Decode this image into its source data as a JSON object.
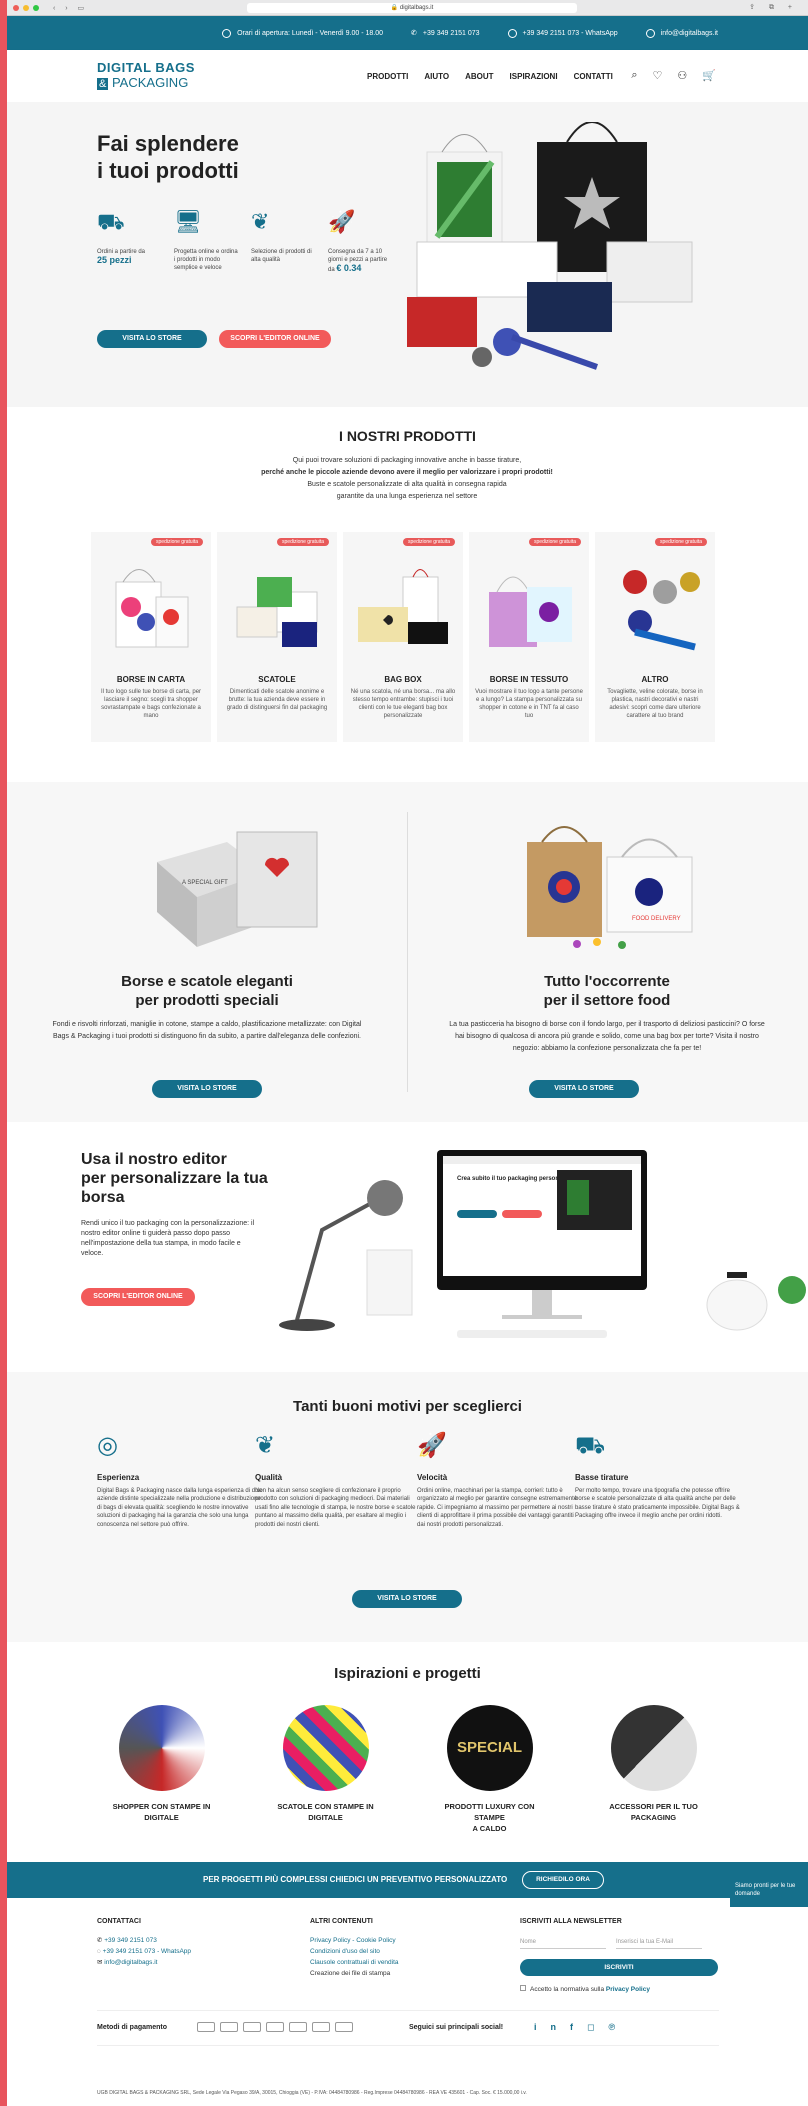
{
  "browser": {
    "url": "digitalbags.it"
  },
  "topbar": {
    "hours": "Orari di apertura: Lunedì - Venerdì 9.00 - 18.00",
    "phone": "+39 349 2151 073",
    "whatsapp": "+39 349 2151 073 - WhatsApp",
    "email": "info@digitalbags.it"
  },
  "header": {
    "logo_line1": "DIGITAL BAGS",
    "logo_amp": "&",
    "logo_line2": "PACKAGING",
    "menu": [
      "PRODOTTI",
      "AIUTO",
      "ABOUT",
      "ISPIRAZIONI",
      "CONTATTI"
    ]
  },
  "hero": {
    "title_line1": "Fai splendere",
    "title_line2": "i tuoi prodotti",
    "features": [
      {
        "text": "Ordini a partire da",
        "highlight": "25 pezzi"
      },
      {
        "text": "Progetta online e ordina i prodotti in modo semplice e veloce",
        "highlight": ""
      },
      {
        "text": "Selezione di prodotti di alta qualità",
        "highlight": ""
      },
      {
        "text": "Consegna da 7 a 10 giorni e pezzi a partire da",
        "highlight": "€ 0.34"
      }
    ],
    "btn_store": "VISITA LO STORE",
    "btn_editor": "SCOPRI L'EDITOR ONLINE"
  },
  "products": {
    "title": "I NOSTRI PRODOTTI",
    "intro": [
      "Qui puoi trovare soluzioni di packaging innovative anche in basse tirature,",
      "perché anche le piccole aziende devono avere il meglio per valorizzare i propri prodotti!",
      "Buste e scatole personalizzate di alta qualità in consegna rapida",
      "garantite da una lunga esperienza nel settore"
    ],
    "badge": "spedizione gratuita",
    "items": [
      {
        "name": "BORSE IN CARTA",
        "desc": "Il tuo logo sulle tue borse di carta, per lasciare il segno: scegli tra shopper sovrastampate e bags confezionate a mano"
      },
      {
        "name": "SCATOLE",
        "desc": "Dimenticati delle scatole anonime e brutte: la tua azienda deve essere in grado di distinguersi fin dal packaging"
      },
      {
        "name": "BAG BOX",
        "desc": "Né una scatola, né una borsa... ma allo stesso tempo entrambe: stupisci i tuoi clienti con le tue eleganti bag box personalizzate"
      },
      {
        "name": "BORSE IN TESSUTO",
        "desc": "Vuoi mostrare il tuo logo a tante persone e a lungo? La stampa personalizzata su shopper in cotone e in TNT fa al caso tuo"
      },
      {
        "name": "ALTRO",
        "desc": "Tovagliette, veline colorate, borse in plastica, nastri decorativi e nastri adesivi: scopri come dare ulteriore carattere al tuo brand"
      }
    ]
  },
  "split": {
    "left": {
      "title_line1": "Borse e scatole eleganti",
      "title_line2": "per prodotti speciali",
      "desc": "Fondi e risvolti rinforzati, maniglie in cotone, stampe a caldo, plastificazione metallizzate: con Digital Bags & Packaging i tuoi prodotti si distinguono fin da subito, a partire dall'eleganza delle confezioni.",
      "btn": "VISITA LO STORE",
      "box_label": "A SPECIAL GIFT"
    },
    "right": {
      "title_line1": "Tutto l'occorrente",
      "title_line2": "per il settore food",
      "desc": "La tua pasticceria ha bisogno di borse con il fondo largo, per il trasporto di deliziosi pasticcini? O forse hai bisogno di qualcosa di ancora più grande e solido, come una bag box per torte? Visita il nostro negozio: abbiamo la confezione personalizzata che fa per te!",
      "btn": "VISITA LO STORE",
      "bag_label": "FOOD DELIVERY"
    }
  },
  "editor": {
    "title_line1": "Usa il nostro editor",
    "title_line2": "per personalizzare la tua",
    "title_line3": "borsa",
    "desc": "Rendi unico il tuo packaging con la personalizzazione: il nostro editor online ti guiderà passo dopo passo nell'impostazione della tua stampa, in modo facile e veloce.",
    "btn": "SCOPRI L'EDITOR ONLINE",
    "screen_title": "Crea subito il tuo packaging personalizzato"
  },
  "reasons": {
    "title": "Tanti buoni motivi per sceglierci",
    "items": [
      {
        "title": "Esperienza",
        "desc": "Digital Bags & Packaging nasce dalla lunga esperienza di due aziende distinte specializzate nella produzione e distribuzione di bags di elevata qualità: scegliendo le nostre innovative soluzioni di packaging hai la garanzia che solo una lunga conoscenza nel settore può offrire."
      },
      {
        "title": "Qualità",
        "desc": "Non ha alcun senso scegliere di confezionare il proprio prodotto con soluzioni di packaging mediocri. Dai materiali usati fino alle tecnologie di stampa, le nostre borse e scatole puntano al massimo della qualità, per esaltare al meglio i prodotti dei nostri clienti."
      },
      {
        "title": "Velocità",
        "desc": "Ordini online, macchinari per la stampa, corrieri: tutto è organizzato al meglio per garantire consegne estremamente rapide. Ci impegniamo al massimo per permettere ai nostri clienti di approfittare il prima possibile dei vantaggi garantiti dai nostri prodotti personalizzati."
      },
      {
        "title": "Basse tirature",
        "desc": "Per molto tempo, trovare una tipografia che potesse offrire borse e scatole personalizzate di alta qualità anche per delle basse tirature è stato praticamente impossibile. Digital Bags & Packaging offre invece il meglio anche per ordini ridotti."
      }
    ],
    "btn": "VISITA LO STORE"
  },
  "inspirations": {
    "title": "Ispirazioni e progetti",
    "items": [
      {
        "line1": "SHOPPER CON STAMPE IN",
        "line2": "DIGITALE"
      },
      {
        "line1": "SCATOLE CON STAMPE IN",
        "line2": "DIGITALE"
      },
      {
        "line1": "PRODOTTI LUXURY CON STAMPE",
        "line2": "A CALDO",
        "circle_text": "SPECIAL"
      },
      {
        "line1": "ACCESSORI PER IL TUO",
        "line2": "PACKAGING"
      }
    ]
  },
  "cta": {
    "text": "PER PROGETTI PIÙ COMPLESSI CHIEDICI UN PREVENTIVO PERSONALIZZATO",
    "btn": "RICHIEDILO ORA"
  },
  "footer": {
    "contacts_title": "CONTATTACI",
    "phone": "+39 349 2151 073",
    "whatsapp": "+39 349 2151 073 - WhatsApp",
    "email": "info@digitalbags.it",
    "other_title": "ALTRI CONTENUTI",
    "links": [
      "Privacy Policy - Cookie Policy",
      "Condizioni d'uso del sito",
      "Clausole contrattuali di vendita"
    ],
    "other_plain": "Creazione dei file di stampa",
    "newsletter_title": "ISCRIVITI ALLA NEWSLETTER",
    "name_ph": "Nome",
    "email_ph": "Inserisci la tua E-Mail",
    "subscribe": "ISCRIVITI",
    "accept_text": "Accetto la normativa sulla",
    "accept_link": "Privacy Policy",
    "payments_title": "Metodi di pagamento",
    "payment_icons": [
      "visa-icon",
      "mastercard-icon",
      "amex-icon",
      "maestro-icon",
      "paypal-icon",
      "diners-icon",
      "visa-electron-icon"
    ],
    "social_title": "Seguici sui principali social!",
    "legal": "UGB DIGITAL BAGS & PACKAGING SRL, Sede Legale Via Pegaso 39/A, 30015, Chioggia (VE) - P.IVA: 04484780986 - Reg.Imprese 04484780986 - REA VE 435601 - Cap. Soc. € 15.000,00 i.v."
  },
  "chat": {
    "text": "Siamo pronti per le tue domande"
  },
  "colors": {
    "brand": "#156f8b",
    "accent": "#f25a5a",
    "badge": "#e85a5a"
  }
}
